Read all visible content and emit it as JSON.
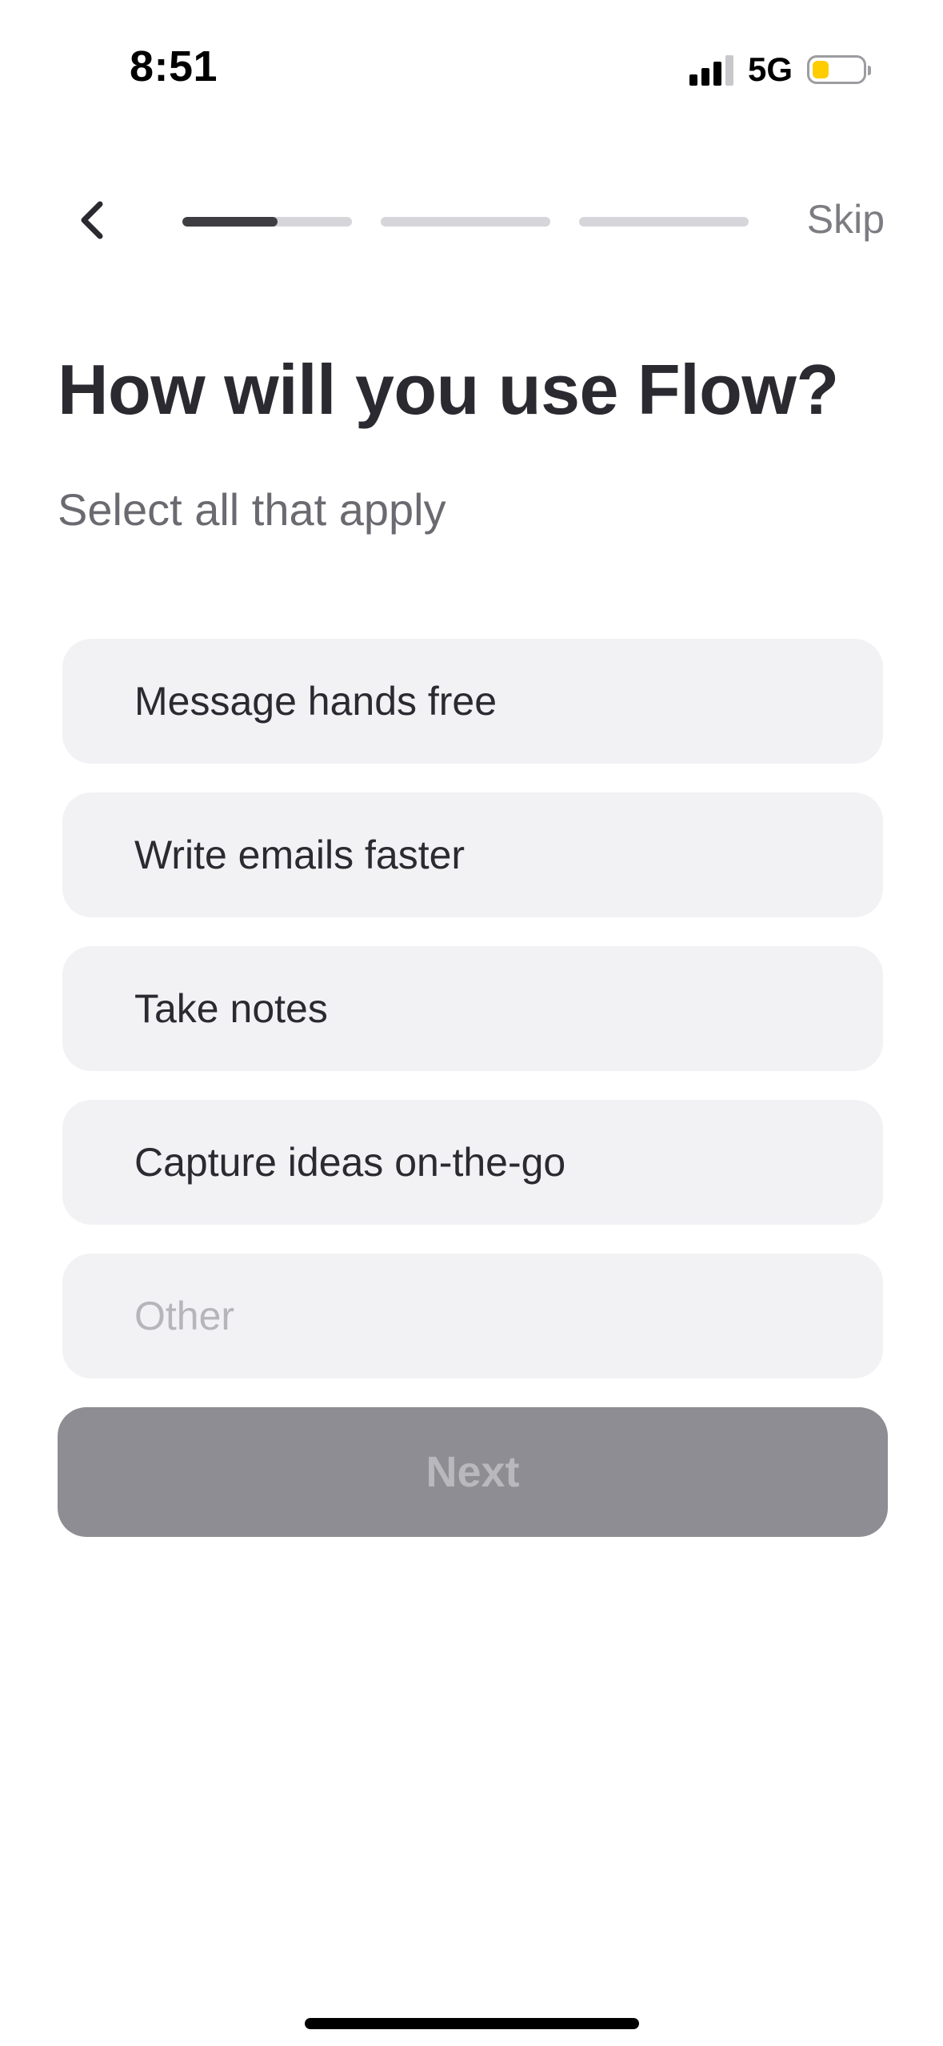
{
  "status_bar": {
    "time": "8:51",
    "network": "5G",
    "signal_bars_active": 3,
    "signal_bars_total": 4,
    "battery_level": 0.25,
    "battery_color": "#ffcc00"
  },
  "nav": {
    "back_icon": "chevron-left-icon",
    "skip_label": "Skip",
    "progress": {
      "total_steps": 3,
      "current_step": 1,
      "current_step_fill": 0.56
    }
  },
  "page": {
    "title": "How will you use Flow?",
    "subtitle": "Select all that apply"
  },
  "options": [
    {
      "label": "Message hands free"
    },
    {
      "label": "Write emails faster"
    },
    {
      "label": "Take notes"
    },
    {
      "label": "Capture ideas on-the-go"
    }
  ],
  "other_input": {
    "placeholder": "Other",
    "value": ""
  },
  "next_button": {
    "label": "Next",
    "enabled": false
  },
  "colors": {
    "text_primary": "#2b2a30",
    "option_bg": "#f2f1f4",
    "button_disabled_bg": "#8e8d93",
    "progress_active": "#3e3d42",
    "progress_inactive": "#d6d5d9"
  }
}
